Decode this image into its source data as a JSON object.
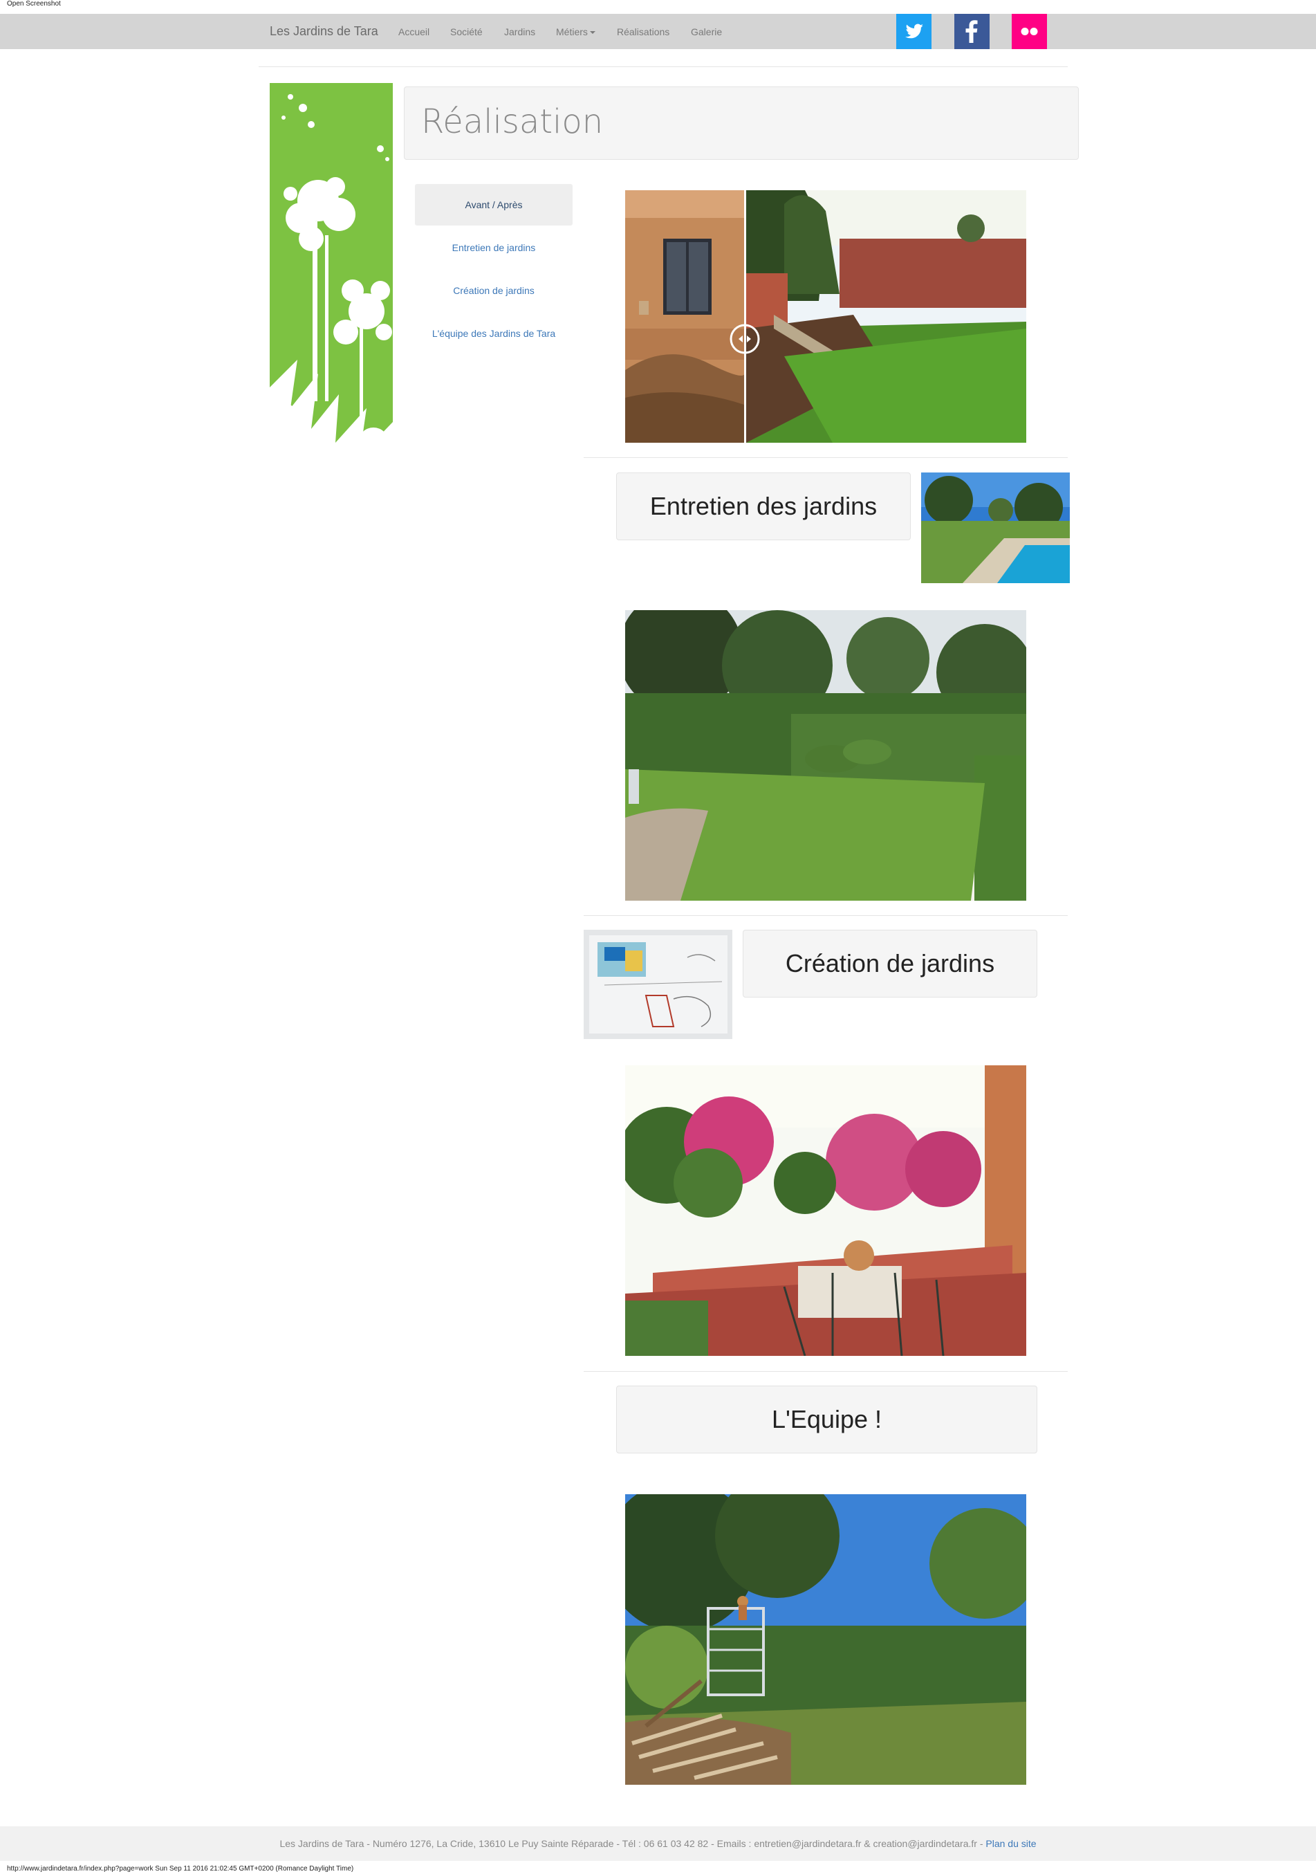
{
  "browser": {
    "top_caption": "Open Screenshot",
    "status_line": "http://www.jardindetara.fr/index.php?page=work Sun Sep 11 2016 21:02:45 GMT+0200 (Romance Daylight Time)"
  },
  "navbar": {
    "brand": "Les Jardins de Tara",
    "links": [
      "Accueil",
      "Société",
      "Jardins",
      "Métiers",
      "Réalisations",
      "Galerie"
    ],
    "social": [
      {
        "name": "twitter",
        "color": "#1da1f2"
      },
      {
        "name": "facebook",
        "color": "#3b5998"
      },
      {
        "name": "flickr",
        "color": "#ff0084"
      }
    ]
  },
  "page": {
    "title": "Réalisation"
  },
  "subnav": {
    "items": [
      "Avant / Après",
      "Entretien de jardins",
      "Création de jardins",
      "L'équipe des Jardins de Tara"
    ],
    "active_index": 0
  },
  "sections": {
    "entretien_heading": "Entretien des jardins",
    "creation_heading": "Création de jardins",
    "equipe_heading": "L'Equipe !"
  },
  "footer": {
    "text": "Les Jardins de Tara - Numéro 1276, La Cride, 13610 Le Puy Sainte Réparade - Tél : 06 61 03 42 82 - Emails : entretien@jardindetara.fr & creation@jardindetara.fr - ",
    "link_label": "Plan du site"
  },
  "colors": {
    "accent_green": "#7dc242",
    "link_blue": "#3d78b8",
    "navbar_bg": "#d4d4d4"
  }
}
